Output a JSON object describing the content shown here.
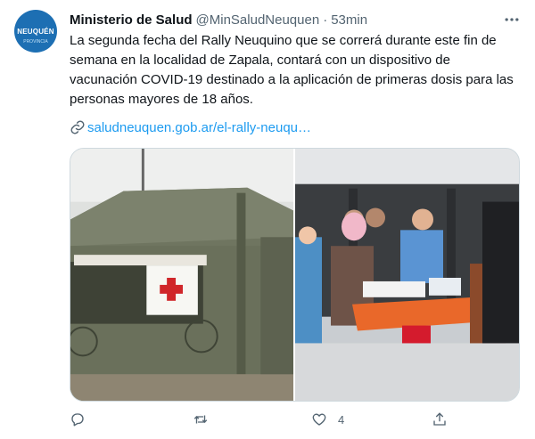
{
  "tweet": {
    "author_name": "Ministerio de Salud",
    "handle": "@MinSaludNeuquen",
    "separator": "·",
    "time": "53min",
    "text": "La segunda fecha del Rally Neuquino que se correrá durante este fin de semana en la localidad de Zapala, contará con un dispositivo de vacunación COVID-19 destinado a la aplicación de primeras dosis para las personas mayores de 18 años.",
    "link": "saludneuquen.gob.ar/el-rally-neuqu…",
    "avatar_text": "NEUQUÉN",
    "avatar_subtext": "PROVINCIA",
    "actions": {
      "reply_count": "",
      "retweet_count": "",
      "like_count": "4",
      "share_count": ""
    }
  },
  "colors": {
    "text": "#0f1419",
    "secondary": "#536471",
    "link": "#1d9bf0",
    "border": "#cfd9de",
    "avatar_bg": "#1d6fb3"
  },
  "icons": [
    "more-icon",
    "link-icon",
    "reply-icon",
    "retweet-icon",
    "like-icon",
    "share-icon"
  ]
}
